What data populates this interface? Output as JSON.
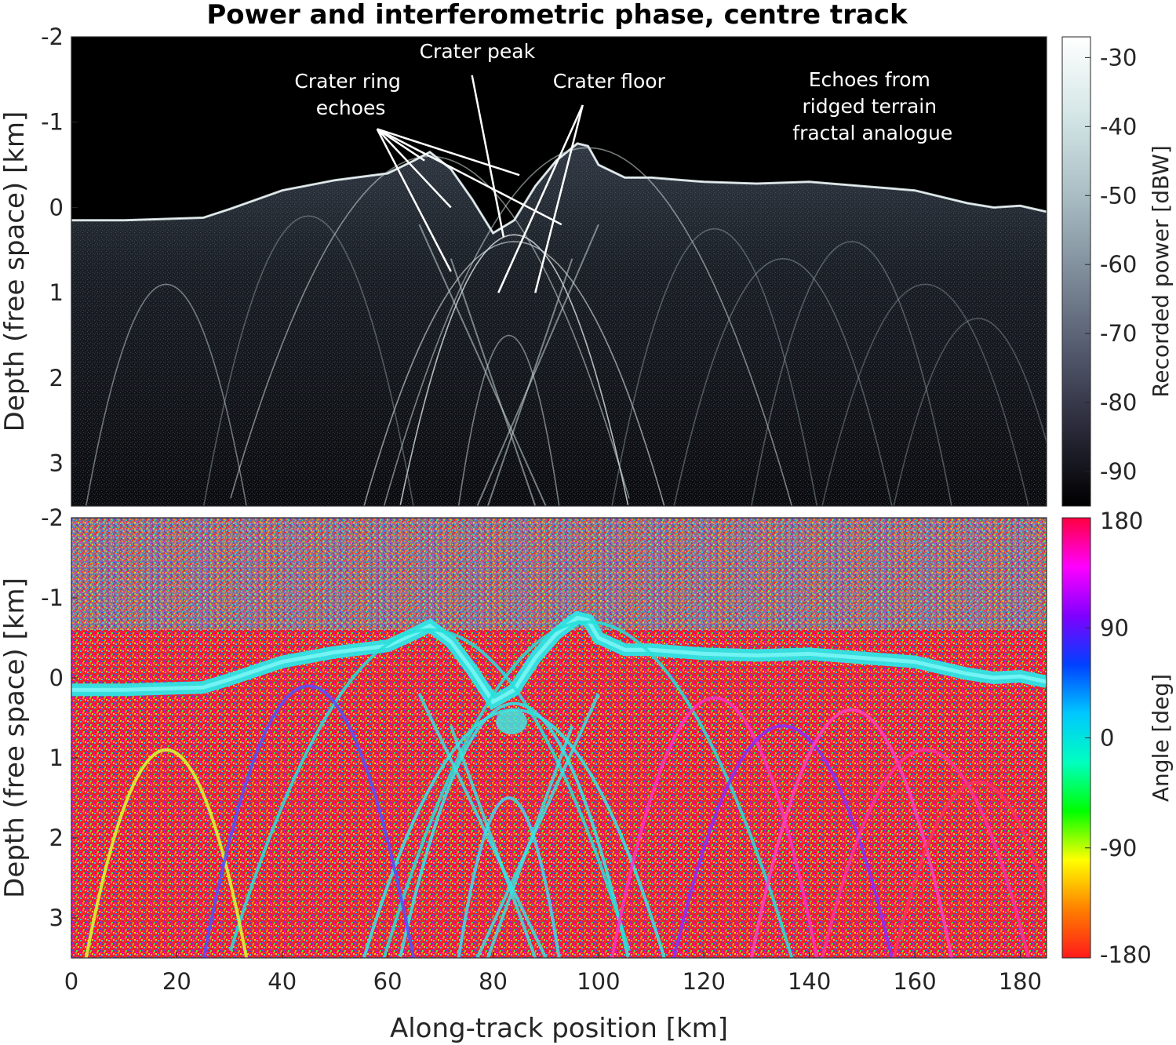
{
  "chart_data": [
    {
      "type": "heatmap",
      "title": "Power and interferometric phase, centre track",
      "ylabel": "Depth (free space) [km]",
      "xlim": [
        0,
        185
      ],
      "ylim": [
        -2,
        3.5
      ],
      "y_reversed": true,
      "yticks": [
        "-2",
        "-1",
        "0",
        "1",
        "2",
        "3"
      ],
      "yticks_values": [
        -2,
        -1,
        0,
        1,
        2,
        3
      ],
      "colorbar": {
        "label": "Recorded power [dBW]",
        "ticks": [
          "-30",
          "-40",
          "-50",
          "-60",
          "-70",
          "-80",
          "-90"
        ],
        "ticks_values": [
          -30,
          -40,
          -50,
          -60,
          -70,
          -80,
          -90
        ],
        "range": [
          -95,
          -27
        ],
        "colormap": "bone",
        "colors": [
          "#000000",
          "#2a2a3a",
          "#545a6e",
          "#7f8d9b",
          "#aabfc5",
          "#d4e6e6",
          "#ffffff"
        ]
      },
      "surface_profile": {
        "x": [
          0,
          10,
          25,
          30,
          40,
          50,
          60,
          65,
          68,
          72,
          76,
          80,
          84,
          88,
          92,
          96,
          98,
          100,
          105,
          110,
          120,
          130,
          140,
          150,
          160,
          170,
          175,
          180,
          185
        ],
        "y": [
          0.15,
          0.15,
          0.12,
          0.02,
          -0.2,
          -0.32,
          -0.4,
          -0.55,
          -0.65,
          -0.45,
          -0.1,
          0.3,
          0.15,
          -0.25,
          -0.55,
          -0.75,
          -0.72,
          -0.5,
          -0.35,
          -0.35,
          -0.3,
          -0.28,
          -0.3,
          -0.25,
          -0.2,
          -0.05,
          0.0,
          -0.02,
          0.05
        ]
      },
      "annotations": [
        {
          "text": [
            "Crater ring",
            "echoes"
          ]
        },
        {
          "text": [
            "Crater peak"
          ]
        },
        {
          "text": [
            "Crater floor"
          ]
        },
        {
          "text": [
            "Echoes from",
            "ridged terrain",
            "fractal analogue"
          ]
        }
      ]
    },
    {
      "type": "heatmap",
      "xlabel": "Along-track position [km]",
      "ylabel": "Depth (free space) [km]",
      "xlim": [
        0,
        185
      ],
      "ylim": [
        -2,
        3.5
      ],
      "y_reversed": true,
      "xticks": [
        "0",
        "20",
        "40",
        "60",
        "80",
        "100",
        "120",
        "140",
        "160",
        "180"
      ],
      "xticks_values": [
        0,
        20,
        40,
        60,
        80,
        100,
        120,
        140,
        160,
        180
      ],
      "yticks": [
        "-2",
        "-1",
        "0",
        "1",
        "2",
        "3"
      ],
      "yticks_values": [
        -2,
        -1,
        0,
        1,
        2,
        3
      ],
      "colorbar": {
        "label": "Angle [deg]",
        "ticks": [
          "180",
          "90",
          "0",
          "-90",
          "-180"
        ],
        "ticks_values": [
          180,
          90,
          0,
          -90,
          -180
        ],
        "range": [
          -180,
          180
        ],
        "colormap": "hsv",
        "colors": [
          "#ff1a1a",
          "#ff8000",
          "#ffff00",
          "#00ff00",
          "#00ffc0",
          "#00c8ff",
          "#0040ff",
          "#8000ff",
          "#ff00ff",
          "#ff0040"
        ]
      },
      "surface_colour": "#2ee6e6",
      "noise_colour": "#ff2a2a"
    }
  ]
}
